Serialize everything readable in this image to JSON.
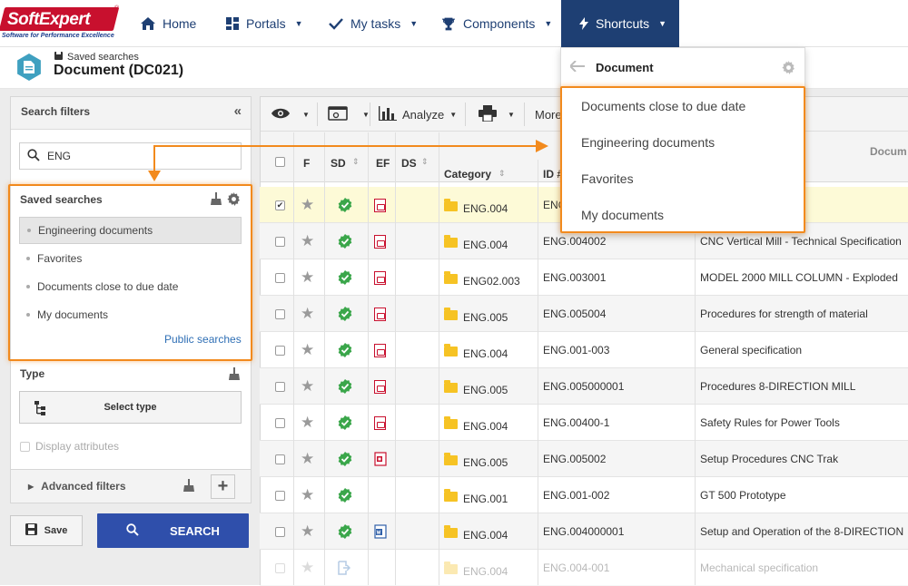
{
  "brand": {
    "name": "SoftExpert",
    "tagline": "Software for Performance Excellence",
    "reg": "®",
    "color": "#c8102e"
  },
  "nav": {
    "items": [
      {
        "label": "Home",
        "icon": "home-icon"
      },
      {
        "label": "Portals",
        "icon": "grid-icon"
      },
      {
        "label": "My tasks",
        "icon": "check-icon"
      },
      {
        "label": "Components",
        "icon": "trophy-icon"
      },
      {
        "label": "Shortcuts",
        "icon": "bolt-icon"
      }
    ],
    "active_color": "#1e3f73"
  },
  "header": {
    "breadcrumb": "Saved searches",
    "title": "Document (DC021)"
  },
  "search_filters": {
    "title": "Search filters",
    "search_value": "ENG",
    "saved_title": "Saved searches",
    "saved_items": [
      "Engineering documents",
      "Favorites",
      "Documents close to due date",
      "My documents"
    ],
    "public_link": "Public searches",
    "type_title": "Type",
    "select_type": "Select type",
    "display_attributes": "Display attributes",
    "advanced_filters": "Advanced filters",
    "save_label": "Save",
    "search_label": "SEARCH"
  },
  "toolbar": {
    "analyze": "Analyze",
    "more": "More"
  },
  "grid": {
    "columns": [
      "F",
      "SD",
      "EF",
      "DS",
      "Category",
      "ID #",
      "Docum"
    ],
    "rows": [
      {
        "category": "ENG.004",
        "id": "ENG",
        "title": "",
        "ef": "pdf",
        "sd": "ok"
      },
      {
        "category": "ENG.004",
        "id": "ENG.004002",
        "title": "CNC Vertical Mill - Technical Specification",
        "ef": "pdf",
        "sd": "ok"
      },
      {
        "category": "ENG02.003",
        "id": "ENG.003001",
        "title": "MODEL 2000 MILL COLUMN - Exploded",
        "ef": "pdf",
        "sd": "ok"
      },
      {
        "category": "ENG.005",
        "id": "ENG.005004",
        "title": "Procedures for strength of material",
        "ef": "pdf",
        "sd": "ok"
      },
      {
        "category": "ENG.004",
        "id": "ENG.001-003",
        "title": "General specification",
        "ef": "pdf",
        "sd": "ok"
      },
      {
        "category": "ENG.005",
        "id": "ENG.005000001",
        "title": "Procedures 8-DIRECTION MILL",
        "ef": "pdf",
        "sd": "ok"
      },
      {
        "category": "ENG.004",
        "id": "ENG.00400-1",
        "title": "Safety Rules for Power Tools",
        "ef": "pdf",
        "sd": "ok"
      },
      {
        "category": "ENG.005",
        "id": "ENG.005002",
        "title": "Setup Procedures CNC Trak",
        "ef": "ppt",
        "sd": "ok"
      },
      {
        "category": "ENG.001",
        "id": "ENG.001-002",
        "title": "GT 500 Prototype",
        "ef": "",
        "sd": "ok"
      },
      {
        "category": "ENG.004",
        "id": "ENG.004000001",
        "title": "Setup and Operation of the 8-DIRECTION",
        "ef": "doc",
        "sd": "ok"
      },
      {
        "category": "ENG.004",
        "id": "ENG.004-001",
        "title": "Mechanical specification",
        "ef": "",
        "sd": "flow"
      }
    ]
  },
  "shortcuts": {
    "title": "Document",
    "items": [
      "Documents close to due date",
      "Engineering documents",
      "Favorites",
      "My documents"
    ]
  },
  "highlight_color": "#f28a1d"
}
